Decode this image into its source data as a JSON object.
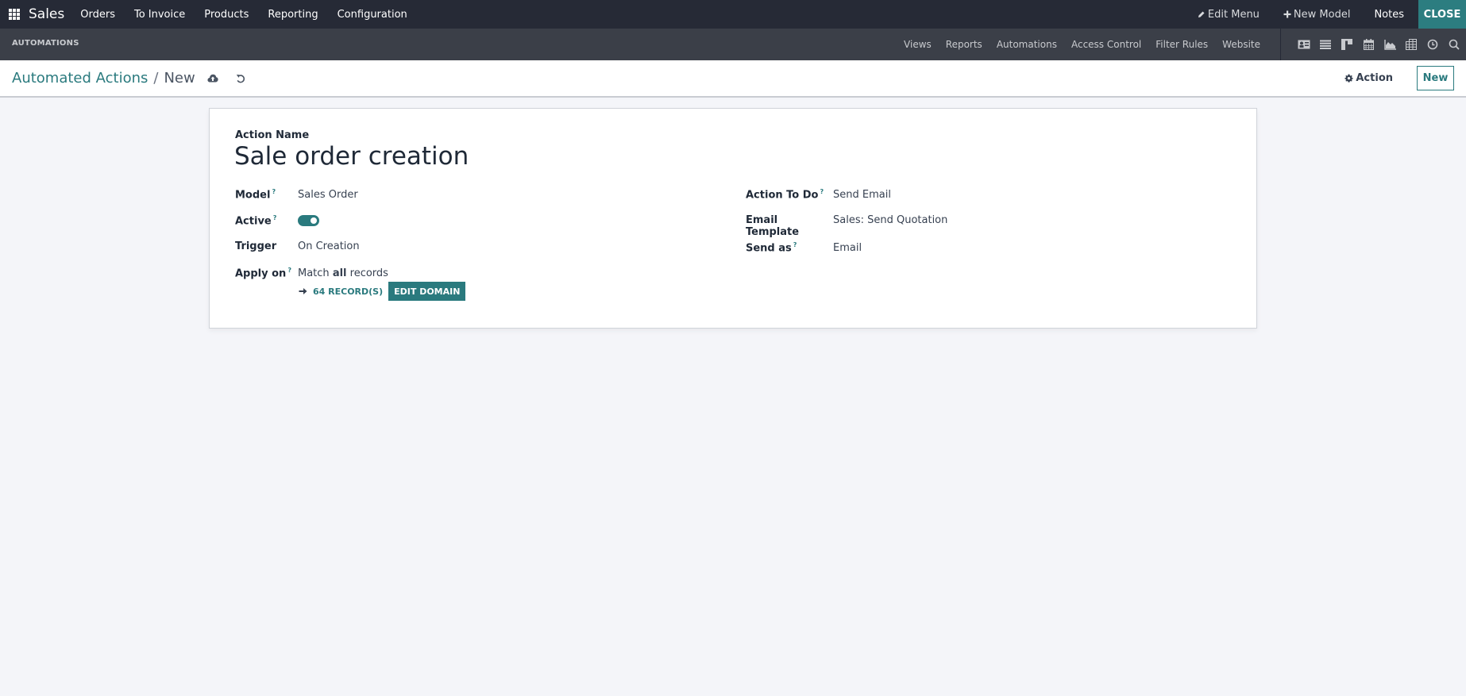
{
  "topbar": {
    "app_name": "Sales",
    "menu": [
      "Orders",
      "To Invoice",
      "Products",
      "Reporting",
      "Configuration"
    ],
    "edit_menu": "Edit Menu",
    "new_model": "New Model",
    "notes": "Notes",
    "close": "CLOSE"
  },
  "subbar": {
    "title": "AUTOMATIONS",
    "menu": [
      "Views",
      "Reports",
      "Automations",
      "Access Control",
      "Filter Rules",
      "Website"
    ],
    "view_icons": [
      "form-view-icon",
      "list-view-icon",
      "kanban-view-icon",
      "calendar-view-icon",
      "graph-view-icon",
      "pivot-view-icon",
      "activity-view-icon",
      "search-icon"
    ]
  },
  "control": {
    "breadcrumb_parent": "Automated Actions",
    "breadcrumb_sep": "/",
    "breadcrumb_current": "New",
    "action_label": "Action",
    "new_label": "New"
  },
  "form": {
    "action_name_label": "Action Name",
    "action_name": "Sale order creation",
    "left": {
      "model_label": "Model",
      "model_value": "Sales Order",
      "active_label": "Active",
      "active_value": true,
      "trigger_label": "Trigger",
      "trigger_value": "On Creation",
      "apply_label": "Apply on",
      "apply_prefix": "Match",
      "apply_bold": "all",
      "apply_suffix": "records",
      "records_count": "64 RECORD(S)",
      "edit_domain": "EDIT DOMAIN"
    },
    "right": {
      "action_to_do_label": "Action To Do",
      "action_to_do_value": "Send Email",
      "email_template_label": "Email Template",
      "email_template_value": "Sales: Send Quotation",
      "send_as_label": "Send as",
      "send_as_value": "Email"
    },
    "help_mark": "?"
  },
  "colors": {
    "accent": "#2a7a7e",
    "navbar": "#262a36",
    "subbar": "#3b3f48",
    "close_bg": "#2c7d80",
    "background": "#f4f5f9"
  }
}
